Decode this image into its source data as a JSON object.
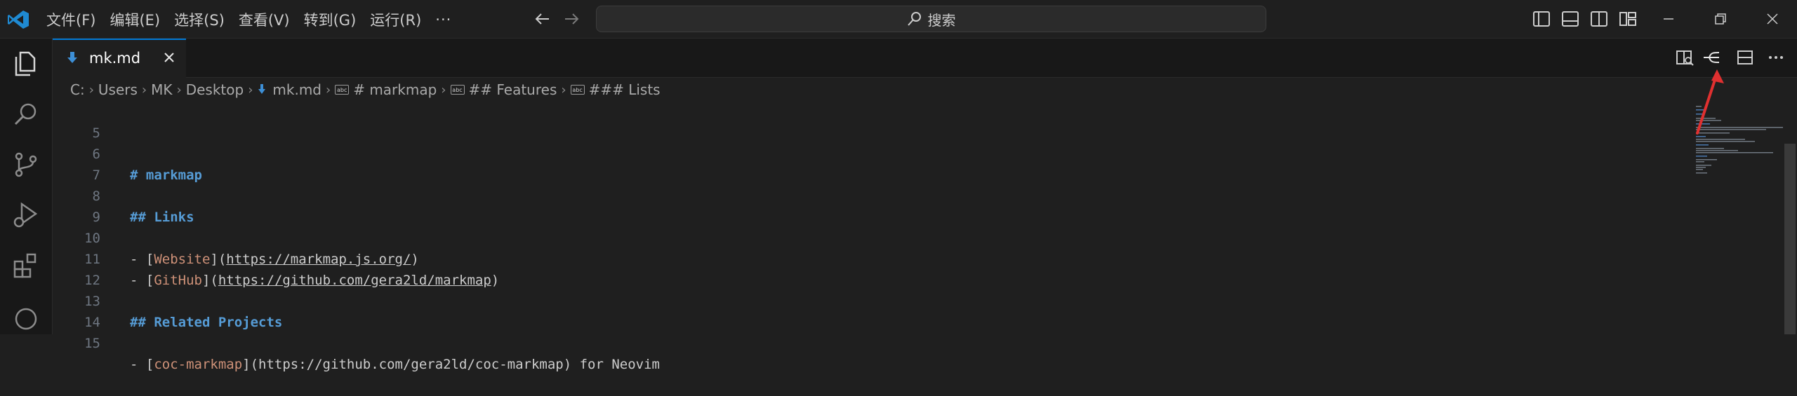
{
  "menu": {
    "file": "文件(F)",
    "edit": "编辑(E)",
    "selection": "选择(S)",
    "view": "查看(V)",
    "goto": "转到(G)",
    "run": "运行(R)",
    "more": "···"
  },
  "search": {
    "label": "搜索"
  },
  "tab": {
    "name": "mk.md"
  },
  "breadcrumb": {
    "drive": "C:",
    "users": "Users",
    "user": "MK",
    "desktop": "Desktop",
    "file": "mk.md",
    "h1": "# markmap",
    "h2": "## Features",
    "h3": "### Lists",
    "symbol_label": "abc"
  },
  "editor": {
    "lines": [
      {
        "num": "5"
      },
      {
        "num": "6",
        "hdr": "# markmap"
      },
      {
        "num": "7"
      },
      {
        "num": "8",
        "hdr": "## Links"
      },
      {
        "num": "9"
      },
      {
        "num": "10",
        "dash": "- [",
        "text": "Website",
        "mid": "](",
        "url": "https://markmap.js.org/",
        "end": ")"
      },
      {
        "num": "11",
        "dash": "- [",
        "text": "GitHub",
        "mid": "](",
        "url": "https://github.com/gera2ld/markmap",
        "end": ")"
      },
      {
        "num": "12"
      },
      {
        "num": "13",
        "hdr": "## Related Projects"
      },
      {
        "num": "14"
      },
      {
        "num": "15",
        "dash": "- [",
        "text": "coc-markmap",
        "mid": "](https://github.com/gera2ld/coc-markmap) for Neovim"
      }
    ]
  },
  "icons": {
    "app": "vscode-logo-icon",
    "back": "arrow-left-icon",
    "forward": "arrow-right-icon",
    "search": "search-icon",
    "layout_sidebar": "toggle-primary-sidebar-icon",
    "layout_panel": "toggle-panel-icon",
    "layout_secondary": "toggle-secondary-sidebar-icon",
    "customize_layout": "customize-layout-icon",
    "minimize": "minimize-icon",
    "restore": "restore-icon",
    "close": "close-icon",
    "explorer": "files-icon",
    "search_view": "search-icon",
    "scm": "source-control-icon",
    "debug": "run-debug-icon",
    "extensions": "extensions-icon",
    "markdown_file": "markdown-file-icon",
    "open_preview": "open-preview-icon",
    "markmap": "markmap-icon",
    "split": "split-editor-icon",
    "more_actions": "more-actions-icon"
  },
  "colors": {
    "accent": "#0078d4",
    "heading": "#569cd6",
    "link_text": "#ce9178",
    "annotation": "#e03030"
  }
}
